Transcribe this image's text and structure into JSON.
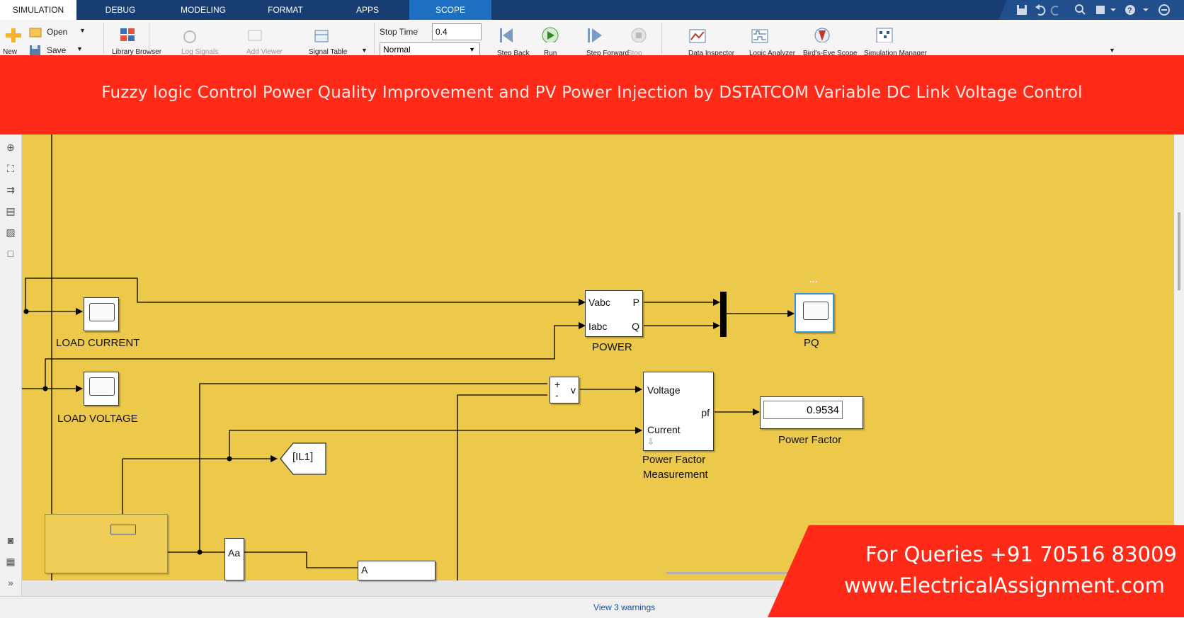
{
  "ribbon": {
    "tabs": [
      "SIMULATION",
      "DEBUG",
      "MODELING",
      "FORMAT",
      "APPS",
      "SCOPE"
    ],
    "active_tab": "SIMULATION"
  },
  "toolstrip": {
    "new_label": "New",
    "open_label": "Open",
    "save_label": "Save",
    "library_label": "Library Browser",
    "log_label": "Log Signals",
    "add_viewer_label": "Add Viewer",
    "signal_table_label": "Signal Table",
    "stop_time_label": "Stop Time",
    "stop_time_value": "0.4",
    "sim_mode": "Normal",
    "step_back_label": "Step Back",
    "run_label": "Run",
    "step_forward_label": "Step Forward",
    "stop_label": "Stop",
    "data_inspector_label": "Data Inspector",
    "logic_analyzer_label": "Logic Analyzer",
    "birds_eye_label": "Bird's-Eye Scope",
    "sim_manager_label": "Simulation Manager"
  },
  "banner": {
    "title": "Fuzzy logic Control Power Quality Improvement and PV Power Injection by DSTATCOM Variable DC Link Voltage Control",
    "color": "#ff2a18"
  },
  "diagram": {
    "load_current_label": "LOAD CURRENT",
    "load_voltage_label": "LOAD VOLTAGE",
    "power_block": {
      "label": "POWER",
      "in1": "Vabc",
      "in2": "Iabc",
      "out1": "P",
      "out2": "Q"
    },
    "pq_label": "PQ",
    "sum_block": {
      "plus": "+",
      "minus": "-",
      "out": "v"
    },
    "pf_block": {
      "in1": "Voltage",
      "in2": "Current",
      "out": "pf",
      "label_line1": "Power Factor",
      "label_line2": "Measurement"
    },
    "display": {
      "value": "0.9534",
      "label": "Power Factor"
    },
    "goto_tag": "[IL1]",
    "aa_block": "Aa",
    "a_block": "A",
    "ellipsis": "...",
    "canvas_color": "#ecc84b"
  },
  "status": {
    "warnings": "View 3 warnings"
  },
  "cta": {
    "line1": "For Queries +91 70516 83009",
    "line2": "www.ElectricalAssignment.com"
  }
}
